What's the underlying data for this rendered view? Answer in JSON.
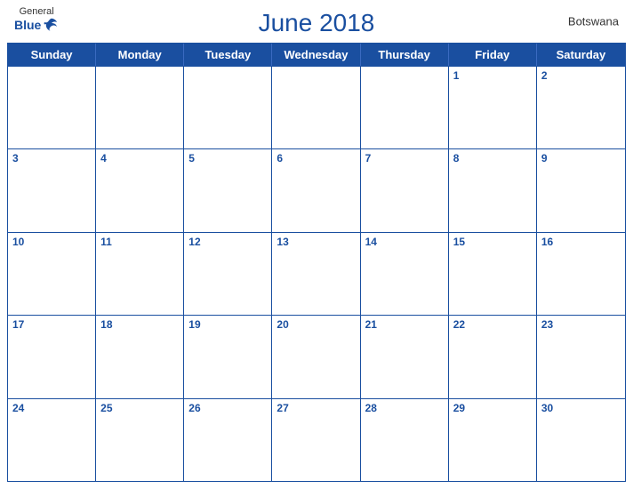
{
  "header": {
    "title": "June 2018",
    "country": "Botswana",
    "logo": {
      "general": "General",
      "blue": "Blue"
    }
  },
  "days_of_week": [
    "Sunday",
    "Monday",
    "Tuesday",
    "Wednesday",
    "Thursday",
    "Friday",
    "Saturday"
  ],
  "weeks": [
    [
      null,
      null,
      null,
      null,
      null,
      1,
      2
    ],
    [
      3,
      4,
      5,
      6,
      7,
      8,
      9
    ],
    [
      10,
      11,
      12,
      13,
      14,
      15,
      16
    ],
    [
      17,
      18,
      19,
      20,
      21,
      22,
      23
    ],
    [
      24,
      25,
      26,
      27,
      28,
      29,
      30
    ]
  ]
}
